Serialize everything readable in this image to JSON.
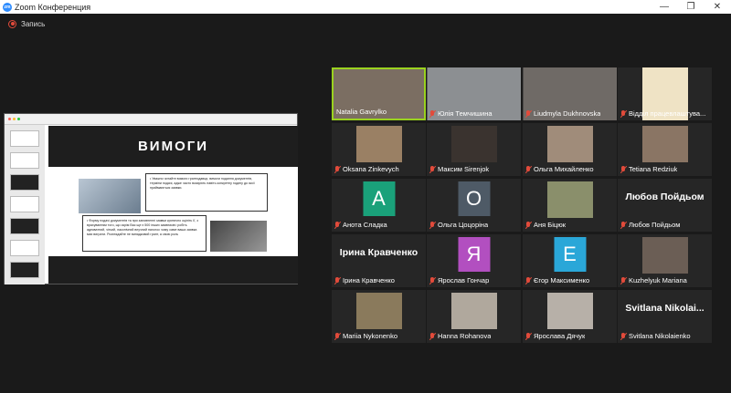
{
  "window": {
    "title": "Zoom Конференция",
    "logo_text": "zm"
  },
  "controls": {
    "minimize": "—",
    "maximize": "❐",
    "close": "✕"
  },
  "recording": {
    "label": "Запись",
    "color": "#e24b3b"
  },
  "shared_screen": {
    "slide_title": "ВИМОГИ",
    "text_top": "• Уважно читайте вимоги грантодавця, вимоги подання документів, терміни подачі, адже часто вказують навіть конкретну годину до якої приймаються заявки.",
    "text_bottom": "• Форму подачі документів та при заповненні заявки критично оцініть її, з врахуванням того, що окрім Вас ще є 500 інших заявників і робіть адекватний, чіткий, лаконічний влучний наголос чому саме ваша заявка має виграти. Розглядайте не випадковий грант, а свою роль"
  },
  "participants": [
    {
      "name": "Natalia Gavrylko",
      "muted": false,
      "active": true,
      "type": "video"
    },
    {
      "name": "Юлія Темчишина",
      "muted": true,
      "type": "video"
    },
    {
      "name": "Liudmyla Dukhnovska",
      "muted": true,
      "type": "video"
    },
    {
      "name": "Відділ працевлаштува...",
      "muted": true,
      "type": "logo"
    },
    {
      "name": "Oksana Zinkevych",
      "muted": true,
      "type": "video"
    },
    {
      "name": "Максим Sirenjok",
      "muted": true,
      "type": "video"
    },
    {
      "name": "Ольга Михайленко",
      "muted": true,
      "type": "video"
    },
    {
      "name": "Tetiana Redziuk",
      "muted": true,
      "type": "video"
    },
    {
      "name": "Анота Сладка",
      "muted": true,
      "type": "letter",
      "letter": "А",
      "color": "#1aa17a"
    },
    {
      "name": "Ольга Цоцоріна",
      "muted": true,
      "type": "letter",
      "letter": "О",
      "color": "#4e5a66"
    },
    {
      "name": "Аня Біцюк",
      "muted": true,
      "type": "video"
    },
    {
      "name": "Любов Пойдьом",
      "muted": true,
      "type": "text",
      "bigname": "Любов Пойдьом"
    },
    {
      "name": "Ірина Кравченко",
      "muted": true,
      "type": "text",
      "bigname": "Ірина Кравченко"
    },
    {
      "name": "Ярослав Гончар",
      "muted": true,
      "type": "letter",
      "letter": "Я",
      "color": "#b24fc0"
    },
    {
      "name": "Єгор Максименко",
      "muted": true,
      "type": "letter",
      "letter": "Е",
      "color": "#2aa7d8"
    },
    {
      "name": "Kuzhelyuk Mariana",
      "muted": true,
      "type": "video"
    },
    {
      "name": "Mariia Nykonenko",
      "muted": true,
      "type": "video"
    },
    {
      "name": "Hanna Rohanova",
      "muted": true,
      "type": "video"
    },
    {
      "name": "Ярослава Дячук",
      "muted": true,
      "type": "video"
    },
    {
      "name": "Svitlana Nikolaienko",
      "muted": true,
      "type": "text",
      "bigname": "Svitlana  Nikolai..."
    }
  ]
}
